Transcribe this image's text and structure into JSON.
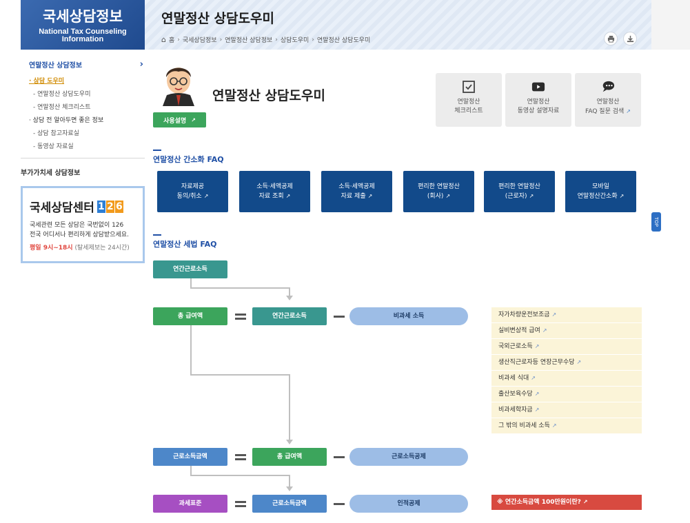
{
  "brand": {
    "title": "국세상담정보",
    "subtitle_line1": "National Tax Counseling",
    "subtitle_line2": "Information"
  },
  "header": {
    "title": "연말정산 상담도우미",
    "breadcrumb": [
      "홈",
      "국세상담정보",
      "연말정산 상담정보",
      "상담도우미",
      "연말정산 상담도우미"
    ],
    "tools": {
      "print_icon": "print-icon",
      "download_icon": "download-icon"
    }
  },
  "side_tab_label": "TOP",
  "sidebar": {
    "head": "연말정산 상담정보",
    "items": [
      {
        "label": "· 상담 도우미",
        "type": "item",
        "active": true
      },
      {
        "label": "- 연말정산 상담도우미",
        "type": "sub"
      },
      {
        "label": "- 연말정산 체크리스트",
        "type": "sub"
      },
      {
        "label": "· 상담 전 알아두면 좋은 정보",
        "type": "item"
      },
      {
        "label": "- 상담 참고자료실",
        "type": "sub"
      },
      {
        "label": "- 동영상 자료실",
        "type": "sub"
      }
    ],
    "other": "부가가치세 상담정보"
  },
  "center": {
    "title": "국세상담센터",
    "num": [
      "1",
      "2",
      "6"
    ],
    "desc_line1": "국세관련 모든 상담은 국번없이 126",
    "desc_line2": "전국 어디서나 편리하게 상담받으세요.",
    "hours": "평일 9시~18시",
    "hours_note": "(탈세제보는 24시간)"
  },
  "hero": {
    "title": "연말정산 상담도우미",
    "guide_button": "사용설명"
  },
  "quick_links": [
    {
      "line1": "연말정산",
      "line2": "체크리스트",
      "icon": "checkbox-icon"
    },
    {
      "line1": "연말정산",
      "line2": "동영상 설명자료",
      "icon": "video-play-icon"
    },
    {
      "line1": "연말정산",
      "line2": "FAQ 질문 검색",
      "icon": "chat-bubble-icon"
    }
  ],
  "section1": {
    "title": "연말정산 간소화 FAQ",
    "buttons": [
      {
        "line1": "자료제공",
        "line2": "동의/취소"
      },
      {
        "line1": "소득·세액공제",
        "line2": "자료 조회"
      },
      {
        "line1": "소득·세액공제",
        "line2": "자료 제출"
      },
      {
        "line1": "편리한 연말정산",
        "line2": "(회사)"
      },
      {
        "line1": "편리한 연말정산",
        "line2": "(근로자)"
      },
      {
        "line1": "모바일",
        "line2": "연말정산간소화"
      }
    ]
  },
  "section2": {
    "title": "연말정산 세법 FAQ",
    "annual_income": "연간근로소득",
    "row1": {
      "left": "총 급여액",
      "mid": "연간근로소득",
      "right": "비과세 소득"
    },
    "row2": {
      "left": "근로소득금액",
      "mid": "총 급여액",
      "right": "근로소득공제"
    },
    "row3": {
      "left": "과세표준",
      "mid": "근로소득금액",
      "right": "인적공제"
    },
    "nontax_items": [
      "자가차량운전보조금",
      "실비변상적 급여",
      "국외근로소득",
      "생산직근로자등 연장근무수당",
      "비과세 식대",
      "출산보육수당",
      "비과세학자금",
      "그 밖의 비과세 소득"
    ],
    "red_note": "※ 연간소득금액 100만원이란?"
  },
  "colors": {
    "brand_blue": "#1f4a8e",
    "navy_button": "#124a8a",
    "teal": "#39978f",
    "green": "#3ca55c",
    "blue": "#4d87c9",
    "purple": "#a64fc2",
    "red": "#d84a40"
  }
}
